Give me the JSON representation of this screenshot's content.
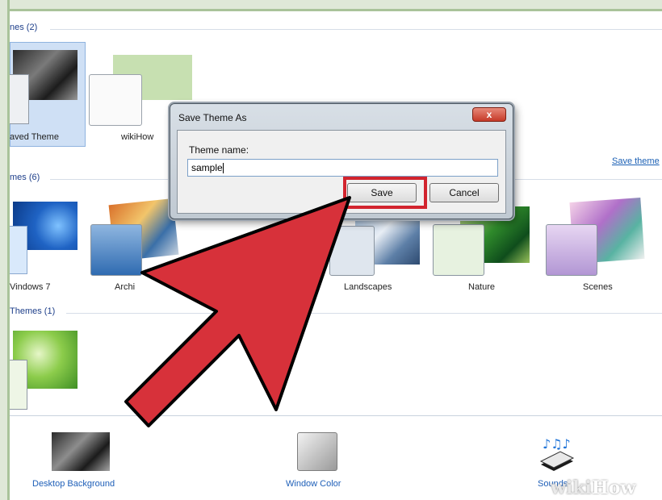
{
  "sections": [
    {
      "label": "nes (2)"
    },
    {
      "label": "mes (6)"
    },
    {
      "label": " Themes (1)"
    }
  ],
  "my_themes": [
    {
      "name": "aved Theme"
    },
    {
      "name": "wikiHow"
    }
  ],
  "aero_themes": [
    {
      "name": "Vindows 7"
    },
    {
      "name": "Archi"
    },
    {
      "name": "Landscapes"
    },
    {
      "name": "Nature"
    },
    {
      "name": "Scenes"
    }
  ],
  "save_theme_link": "Save theme",
  "bottom": [
    {
      "label": "Desktop Background",
      "icon": "desktop-background-icon"
    },
    {
      "label": "Window Color",
      "icon": "window-color-icon"
    },
    {
      "label": "Sounds",
      "icon": "sounds-icon"
    }
  ],
  "dialog": {
    "title": "Save Theme As",
    "close": "x",
    "field_label": "Theme name:",
    "field_value": "sample",
    "save_label": "Save",
    "cancel_label": "Cancel"
  },
  "watermark": {
    "wiki": "wiki",
    "how": "How"
  },
  "colors": {
    "highlight": "#d2242e",
    "arrow": "#d7313a",
    "link": "#1a5fb4"
  }
}
